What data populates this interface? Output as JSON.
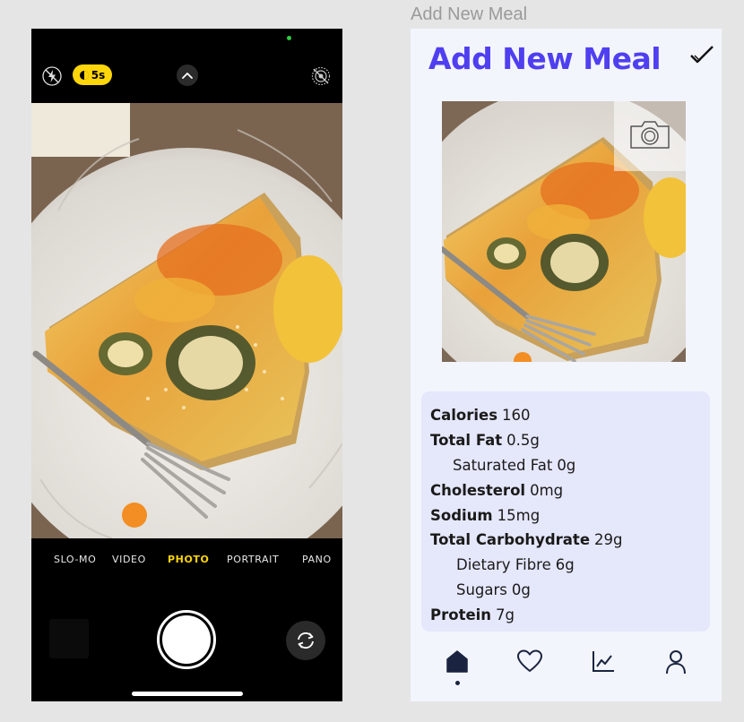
{
  "frame_label": "Add New Meal",
  "camera": {
    "timer_label": "5s",
    "modes": [
      "SLO-MO",
      "VIDEO",
      "PHOTO",
      "PORTRAIT",
      "PANO"
    ],
    "active_mode": "PHOTO",
    "icons": {
      "flash": "flash-off-icon",
      "chevron": "chevron-up-icon",
      "live": "live-photo-off-icon",
      "flip": "flip-camera-icon"
    }
  },
  "meal": {
    "title": "Add New Meal",
    "confirm_icon": "checkmark-icon",
    "photo_overlay_icon": "camera-icon",
    "nutrition": [
      {
        "label": "Calories",
        "value": "160",
        "level": 0
      },
      {
        "label": "Total Fat",
        "value": "0.5g",
        "level": 0
      },
      {
        "label": "Saturated Fat",
        "value": "0g",
        "level": 1
      },
      {
        "label": "Cholesterol",
        "value": "0mg",
        "level": 0
      },
      {
        "label": "Sodium",
        "value": "15mg",
        "level": 0
      },
      {
        "label": "Total Carbohydrate",
        "value": "29g",
        "level": 0
      },
      {
        "label": "Dietary Fibre",
        "value": "6g",
        "level": 2
      },
      {
        "label": "Sugars",
        "value": "0g",
        "level": 2
      },
      {
        "label": "Protein",
        "value": "7g",
        "level": 0
      }
    ]
  },
  "nav": {
    "items": [
      "home-icon",
      "heart-icon",
      "chart-icon",
      "profile-icon"
    ],
    "active": "home-icon"
  },
  "colors": {
    "accent": "#4f3ff0",
    "timer_yellow": "#ffd60a",
    "card_bg": "#e5e7fb",
    "frame_bg": "#f3f5fd"
  }
}
